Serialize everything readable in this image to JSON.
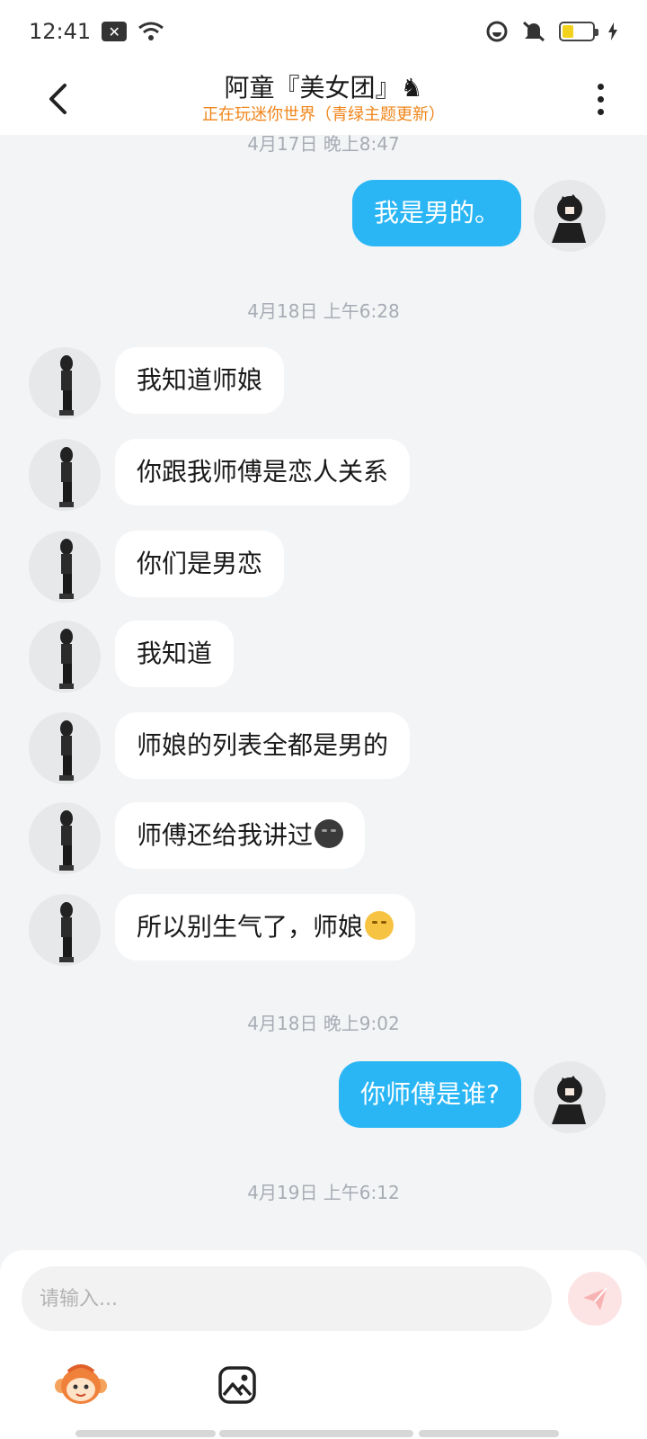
{
  "status_bar": {
    "time": "12:41"
  },
  "header": {
    "title": "阿童『美女团』♞",
    "subtitle": "正在玩迷你世界（青绿主题更新）"
  },
  "messages": {
    "ts1": "4月17日 晚上8:47",
    "m1": "我是男的。",
    "ts2": "4月18日 上午6:28",
    "m2": "我知道师娘",
    "m3": "你跟我师傅是恋人关系",
    "m4": "你们是男恋",
    "m5": "我知道",
    "m6": "师娘的列表全都是男的",
    "m7": "师傅还给我讲过",
    "m8": "所以别生气了，师娘",
    "ts3": "4月18日 晚上9:02",
    "m9": "你师傅是谁?",
    "ts4": "4月19日 上午6:12"
  },
  "composer": {
    "placeholder": "请输入..."
  },
  "colors": {
    "outgoing_bubble": "#2ab6f5",
    "incoming_bubble": "#ffffff",
    "subtitle": "#f0851a",
    "background": "#f3f4f6"
  },
  "icons": {
    "back": "chevron-left-icon",
    "more": "more-vertical-icon",
    "send": "send-icon",
    "emoji_panel": "monkey-mascot-icon",
    "image": "image-icon"
  }
}
